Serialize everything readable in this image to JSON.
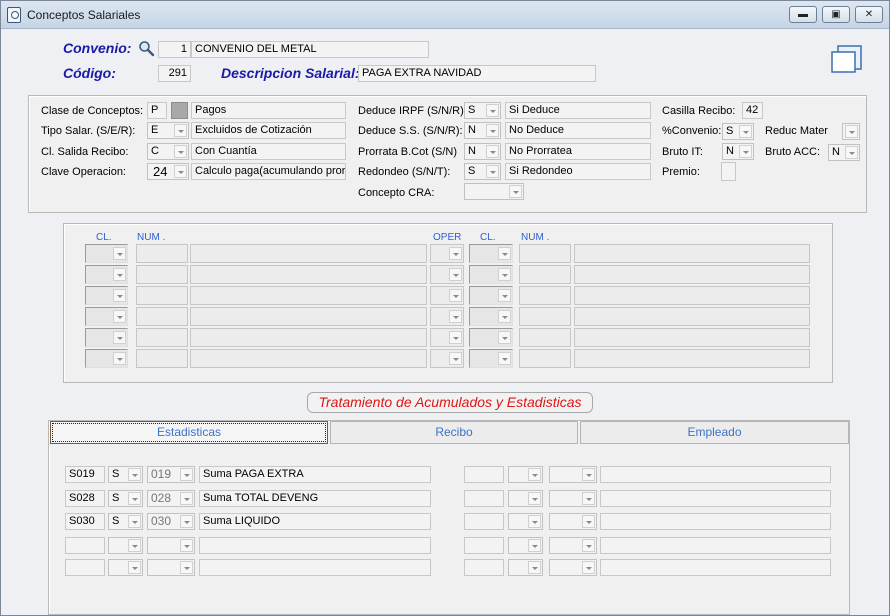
{
  "window": {
    "title": "Conceptos Salariales",
    "minimize_label": "▬",
    "maximize_label": "▣",
    "close_label": "✕"
  },
  "header": {
    "convenio_label": "Convenio:",
    "convenio_code": "1",
    "convenio_name": "CONVENIO DEL METAL",
    "codigo_label": "Código:",
    "codigo_value": "291",
    "descripcion_label": "Descripcion Salarial:",
    "descripcion_value": "PAGA EXTRA NAVIDAD"
  },
  "top_panel": {
    "clase_label": "Clase de Conceptos:",
    "clase_value": "P",
    "clase_desc": "Pagos",
    "tipo_label": "Tipo Salar. (S/E/R):",
    "tipo_value": "E",
    "tipo_desc": "Excluidos de Cotización",
    "salida_label": "Cl. Salida Recibo:",
    "salida_value": "C",
    "salida_desc": "Con Cuantía",
    "clave_label": "Clave Operacion:",
    "clave_value": "24",
    "clave_desc": "Calculo paga(acumulando prorra",
    "irpf_label": "Deduce IRPF (S/N/R):",
    "irpf_value": "S",
    "irpf_desc": "Si Deduce",
    "ss_label": "Deduce S.S. (S/N/R):",
    "ss_value": "N",
    "ss_desc": "No Deduce",
    "prorrata_label": "Prorrata B.Cot (S/N)",
    "prorrata_value": "N",
    "prorrata_desc": "No Prorratea",
    "redondeo_label": "Redondeo (S/N/T):",
    "redondeo_value": "S",
    "redondeo_desc": "Si Redondeo",
    "cra_label": "Concepto CRA:",
    "casilla_label": "Casilla Recibo:",
    "casilla_value": "42",
    "pconvenio_label": "%Convenio:",
    "pconvenio_value": "S",
    "bruto_it_label": "Bruto IT:",
    "bruto_it_value": "N",
    "premio_label": "Premio:",
    "reduc_label": "Reduc Mater",
    "bruto_acc_label": "Bruto ACC:",
    "bruto_acc_value": "N"
  },
  "formula_panel": {
    "col_cl": "CL.",
    "col_num": "NUM .",
    "col_oper": "OPER",
    "col_cl2": "CL.",
    "col_num2": "NUM ."
  },
  "section_title": "Tratamiento de Acumulados y Estadisticas",
  "tabs": [
    "Estadisticas",
    "Recibo",
    "Empleado"
  ],
  "acumulados": [
    {
      "code": "S019",
      "flag": "S",
      "num": "019",
      "desc": "Suma PAGA EXTRA"
    },
    {
      "code": "S028",
      "flag": "S",
      "num": "028",
      "desc": "Suma TOTAL DEVENG"
    },
    {
      "code": "S030",
      "flag": "S",
      "num": "030",
      "desc": "Suma LIQUIDO"
    },
    {
      "code": "",
      "flag": "",
      "num": "",
      "desc": ""
    },
    {
      "code": "",
      "flag": "",
      "num": "",
      "desc": ""
    }
  ]
}
